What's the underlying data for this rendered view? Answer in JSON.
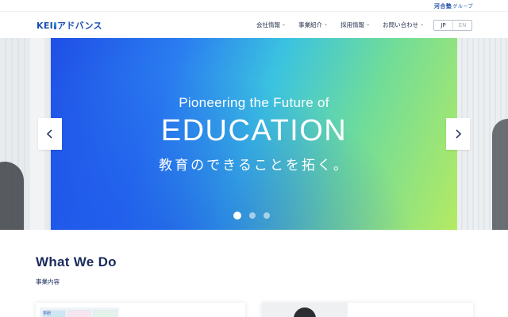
{
  "group": {
    "logo_text": "河合塾",
    "logo_suffix": "グループ"
  },
  "header": {
    "brand_a": "KEI",
    "brand_b": "アドバンス",
    "nav": [
      {
        "label": "会社情報"
      },
      {
        "label": "事業紹介"
      },
      {
        "label": "採用情報"
      },
      {
        "label": "お問い合わせ"
      }
    ],
    "lang": {
      "jp": "JP",
      "en": "EN"
    }
  },
  "hero": {
    "subtitle": "Pioneering the Future of",
    "title": "EDUCATION",
    "tagline": "教育のできることを拓く。",
    "slide_count": 3,
    "active_slide": 1
  },
  "section": {
    "title": "What We Do",
    "subtitle": "事業内容"
  },
  "cards": {
    "thumb_labels": [
      "学研"
    ]
  },
  "colors": {
    "brand": "#1b4fb4",
    "text": "#1a2b5c",
    "gradient_start": "#1f4ee6",
    "gradient_end": "#b4ea63"
  }
}
